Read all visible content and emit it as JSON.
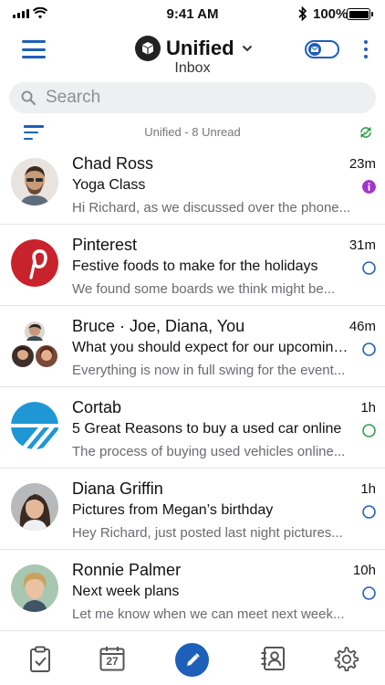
{
  "status_bar": {
    "time": "9:41 AM",
    "battery": "100%"
  },
  "header": {
    "title": "Unified",
    "subtitle": "Inbox"
  },
  "search": {
    "placeholder": "Search"
  },
  "list_header": {
    "label": "Unified - 8 Unread"
  },
  "colors": {
    "accent": "#1e5fb9",
    "purple": "#a335c9",
    "green": "#2aa148"
  },
  "messages": [
    {
      "sender": "Chad Ross",
      "time": "23m",
      "subject": "Yoga Class",
      "preview": "Hi Richard, as we discussed over the phone...",
      "status": "purple-info"
    },
    {
      "sender": "Pinterest",
      "time": "31m",
      "subject": "Festive foods to make for the holidays",
      "preview": "We found some boards we think might be...",
      "status": "blue"
    },
    {
      "sender": "Bruce · Joe, Diana, You",
      "time": "46m",
      "subject": "What you should expect for our upcoming trip",
      "preview": "Everything is now in full swing for the event...",
      "status": "blue"
    },
    {
      "sender": "Cortab",
      "time": "1h",
      "subject": "5 Great Reasons to buy a used car online",
      "preview": "The process of buying used vehicles online...",
      "status": "green"
    },
    {
      "sender": "Diana Griffin",
      "time": "1h",
      "subject": "Pictures from Megan’s birthday",
      "preview": "Hey Richard, just posted last night pictures...",
      "status": "blue"
    },
    {
      "sender": "Ronnie Palmer",
      "time": "10h",
      "subject": "Next week plans",
      "preview": "Let me know when we can meet next week...",
      "status": "blue"
    }
  ],
  "tabbar": {
    "calendar_day": "27"
  }
}
